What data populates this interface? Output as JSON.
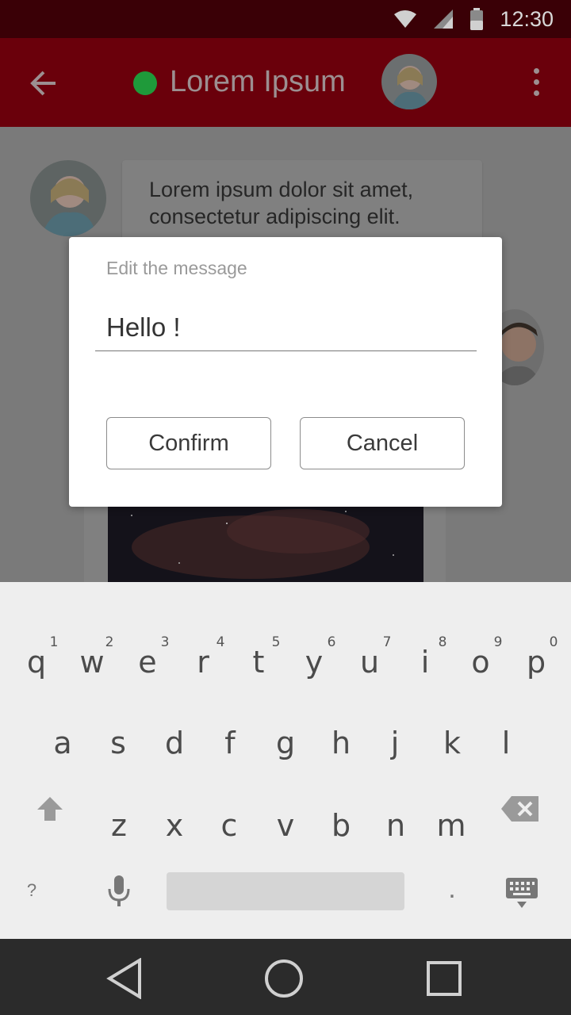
{
  "status_bar": {
    "time": "12:30",
    "icons": [
      "wifi-icon",
      "signal-icon",
      "battery-icon"
    ]
  },
  "app_bar": {
    "title": "Lorem Ipsum",
    "status": "online",
    "back_icon": "arrow-left-icon",
    "menu_icon": "more-vert-icon"
  },
  "chat": {
    "messages": [
      {
        "text": "Lorem ipsum dolor sit amet, consectetur adipiscing elit."
      }
    ]
  },
  "dialog": {
    "label": "Edit the message",
    "input_value": "Hello !",
    "confirm_label": "Confirm",
    "cancel_label": "Cancel"
  },
  "keyboard": {
    "row1": [
      "q",
      "w",
      "e",
      "r",
      "t",
      "y",
      "u",
      "i",
      "o",
      "p"
    ],
    "row1_hints": [
      "1",
      "2",
      "3",
      "4",
      "5",
      "6",
      "7",
      "8",
      "9",
      "0"
    ],
    "row2": [
      "a",
      "s",
      "d",
      "f",
      "g",
      "h",
      "j",
      "k",
      "l"
    ],
    "row3": [
      "z",
      "x",
      "c",
      "v",
      "b",
      "n",
      "m"
    ],
    "symbols_key": "?",
    "period_key": "."
  },
  "colors": {
    "accent": "#6a000b",
    "status_bar": "#3a0006",
    "online": "#1f9a3a",
    "nav_bar": "#2b2b2b"
  }
}
